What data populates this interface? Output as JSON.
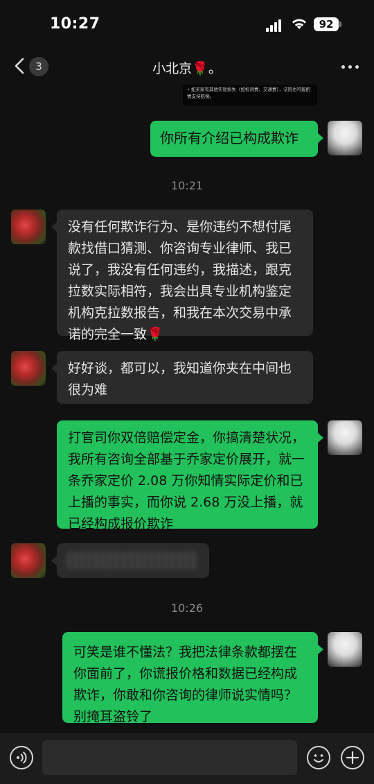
{
  "status_bar": {
    "time": "10:27",
    "battery": "92"
  },
  "nav": {
    "unread_count": "3",
    "title": "小北京🌹。"
  },
  "quoted_card": {
    "text": "• 如买家有其他实际损失（如检测费、交通费），法院也可能酌情支持赔偿。"
  },
  "messages": [
    {
      "from": "self",
      "text": "你所有介绍已构成欺诈"
    },
    {
      "type": "time",
      "text": "10:21"
    },
    {
      "from": "other",
      "text": "没有任何欺诈行为、是你违约不想付尾款找借口猜测、你咨询专业律师、我已说了，我没有任何违约，我描述，跟克拉数实际相符，我会出具专业机构鉴定机构克拉数报告，和我在本次交易中承诺的完全一致🌹"
    },
    {
      "from": "other",
      "text": "好好谈，都可以，我知道你夹在中间也很为难"
    },
    {
      "from": "self",
      "text": "打官司你双倍赔偿定金，你搞清楚状况，我所有咨询全部基于乔家定价展开，就一条乔家定价 2.08 万你知情实际定价和已上播的事实，而你说 2.68 万没上播，就已经构成报价欺诈"
    },
    {
      "from": "other",
      "type": "blurred"
    },
    {
      "type": "time",
      "text": "10:26"
    },
    {
      "from": "self",
      "text": "可笑是谁不懂法？我把法律条款都摆在你面前了，你谎报价格和数据已经构成欺诈，你敢和你咨询的律师说实情吗？别掩耳盗铃了"
    }
  ],
  "input": {
    "placeholder": ""
  },
  "icons": {
    "back": "chevron-left-icon",
    "more": "more-dots-icon",
    "voice": "voice-icon",
    "emoji": "emoji-icon",
    "plus": "plus-icon"
  },
  "colors": {
    "self_bubble": "#22c15b",
    "other_bubble": "#2b2b2b",
    "background": "#111111"
  }
}
